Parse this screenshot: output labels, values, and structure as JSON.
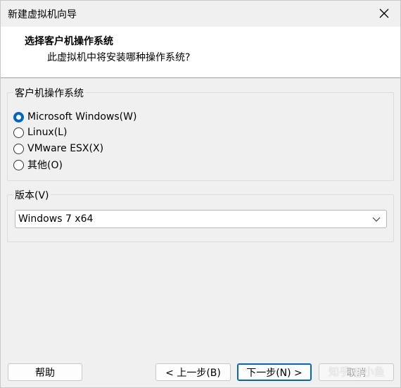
{
  "window": {
    "title": "新建虚拟机向导"
  },
  "header": {
    "title": "选择客户机操作系统",
    "subtitle": "此虚拟机中将安装哪种操作系统?"
  },
  "guest_os": {
    "group_label": "客户机操作系统",
    "options": [
      {
        "label": "Microsoft Windows(W)",
        "checked": true
      },
      {
        "label": "Linux(L)",
        "checked": false
      },
      {
        "label": "VMware ESX(X)",
        "checked": false
      },
      {
        "label": "其他(O)",
        "checked": false
      }
    ]
  },
  "version": {
    "group_label": "版本(V)",
    "selected": "Windows 7 x64"
  },
  "footer": {
    "help": "帮助",
    "back": "< 上一步(B)",
    "next": "下一步(N) >",
    "cancel": "取消"
  },
  "watermark": "知乎 @小鱼",
  "colors": {
    "accent": "#0067c0",
    "background": "#f0f0f0"
  },
  "icons": [
    "close-icon",
    "chevron-down-icon"
  ]
}
